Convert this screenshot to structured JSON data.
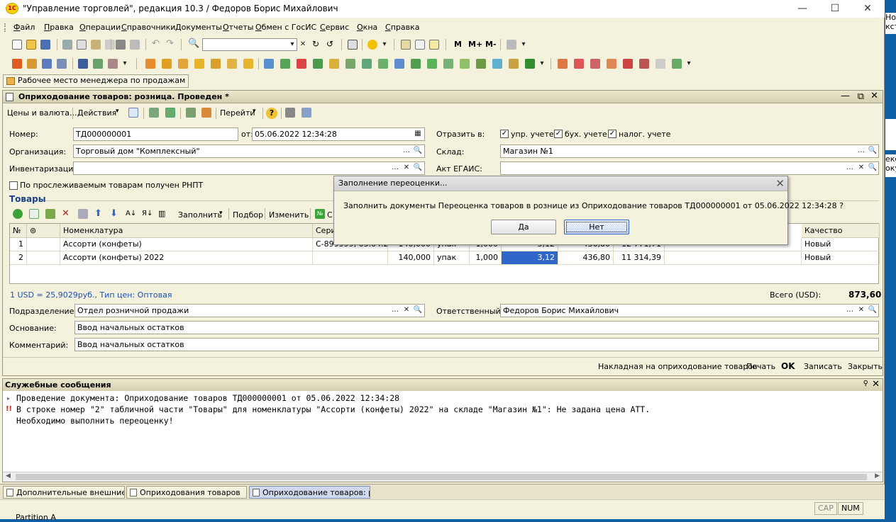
{
  "app": {
    "title": "\"Управление торговлей\", редакция 10.3 / Федоров Борис Михайлович",
    "logo_text": "1С"
  },
  "window_controls": {
    "minimize": "—",
    "maximize": "☐",
    "close": "✕"
  },
  "menu": [
    "Файл",
    "Правка",
    "Операции",
    "Справочники",
    "Документы",
    "Отчеты",
    "Обмен с ГосИС",
    "Сервис",
    "Окна",
    "Справка"
  ],
  "toolbar": {
    "memory_buttons": [
      "M",
      "M+",
      "M-"
    ],
    "search_value": ""
  },
  "desktop_button": "Рабочее место менеджера по продажам",
  "document": {
    "title": "Оприходование товаров: розница. Проведен *",
    "actions": {
      "prices_currency": "Цены и валюта...",
      "actions_menu": "Действия",
      "go_menu": "Перейти",
      "help": "?"
    },
    "labels": {
      "number": "Номер:",
      "from": "от:",
      "organization": "Организация:",
      "inventory": "Инвентаризация:",
      "reflect_in": "Отразить в:",
      "warehouse": "Склад:",
      "egais_act": "Акт ЕГАИС:",
      "rnpt": "По прослеживаемым товарам получен РНПТ",
      "mgmt": "упр. учете",
      "acct": "бух. учете",
      "tax": "налог. учете"
    },
    "values": {
      "number": "ТД000000001",
      "date": "05.06.2022 12:34:28",
      "organization": "Торговый дом \"Комплексный\"",
      "inventory": "",
      "warehouse": "Магазин №1",
      "egais_act": ""
    },
    "checks": {
      "mgmt": true,
      "acct": true,
      "tax": true,
      "rnpt": false
    },
    "goods": {
      "section_title": "Товары",
      "toolbar": {
        "fill": "Заполнить",
        "selection": "Подбор",
        "change": "Изменить",
        "series_short": "С"
      },
      "columns": [
        "№",
        "",
        "Номенклатура",
        "Сери",
        "",
        "",
        "",
        "",
        "",
        "",
        "",
        "Качество"
      ],
      "rows": [
        {
          "n": "1",
          "name": "Ассорти (конфеты)",
          "series": "С-899999, 05.04.2...",
          "qty": "140,000",
          "unit": "упак",
          "coef": "1,000",
          "price": "3,12",
          "amount": "436,80",
          "retail": "12 771,71",
          "quality": "Новый"
        },
        {
          "n": "2",
          "name": "Ассорти (конфеты) 2022",
          "series": "",
          "qty": "140,000",
          "unit": "упак",
          "coef": "1,000",
          "price": "3,12",
          "amount": "436,80",
          "retail": "11 314,39",
          "quality": "Новый"
        }
      ]
    },
    "currency_info": "1 USD = 25,9029руб., Тип цен: Оптовая",
    "total_label": "Всего (USD):",
    "total_value": "873,60",
    "footer_labels": {
      "department": "Подразделение:",
      "responsible": "Ответственный:",
      "basis": "Основание:",
      "comment": "Комментарий:"
    },
    "footer_values": {
      "department": "Отдел розничной продажи",
      "responsible": "Федоров Борис Михайлович",
      "basis": "Ввод начальных остатков",
      "comment": "Ввод начальных остатков"
    },
    "bottom_buttons": {
      "waybill": "Накладная на оприходование товаров",
      "print": "Печать",
      "ok": "OK",
      "save": "Записать",
      "close": "Закрыть"
    }
  },
  "dialog": {
    "title": "Заполнение переоценки...",
    "message": "Заполнить документы Переоценка товаров в рознице из Оприходование товаров ТД000000001 от 05.06.2022 12:34:28 ?",
    "yes": "Да",
    "no": "Нет"
  },
  "messages": {
    "title": "Служебные сообщения",
    "lines": [
      "Проведение документа: Оприходование товаров ТД000000001 от 05.06.2022 12:34:28",
      "В строке номер \"2\" табличной части \"Товары\" для номенклатуры \"Ассорти (конфеты) 2022\" на складе \"Магазин №1\": Не задана цена АТТ.",
      "Необходимо выполнить переоценку!"
    ]
  },
  "taskbar": [
    "Дополнительные внешние о...",
    "Оприходования товаров",
    "Оприходование товаров: ро..."
  ],
  "status": {
    "cap": "CAP",
    "num": "NUM",
    "partition": "Partition A"
  },
  "background_fragments": [
    "Но",
    "кст",
    "еко",
    "оку"
  ]
}
